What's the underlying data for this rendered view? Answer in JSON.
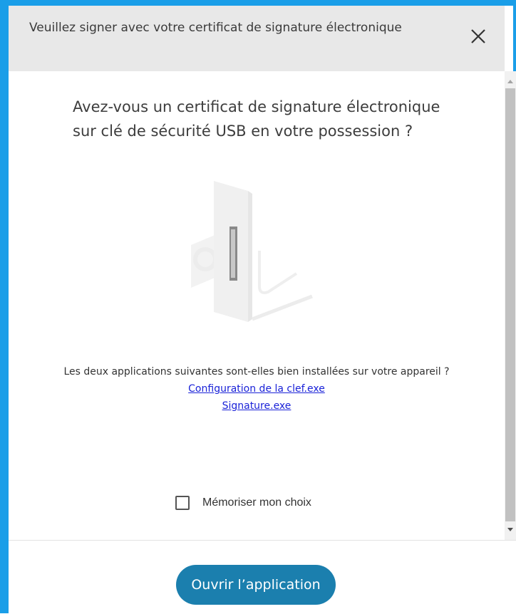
{
  "dialog": {
    "title": "Veuillez signer avec votre certificat de signature électronique",
    "close_icon": "close-icon"
  },
  "content": {
    "question": "Avez-vous un certificat de signature électronique sur clé de sécurité USB en votre possession ?",
    "illustration_icon": "usb-security-key-icon",
    "apps_text": "Les deux applications suivantes sont-elles bien installées sur votre appareil ?",
    "apps": [
      {
        "label": "Configuration de la clef.exe"
      },
      {
        "label": "Signature.exe"
      }
    ],
    "remember_label": "Mémoriser mon choix",
    "remember_checked": false
  },
  "footer": {
    "open_button_label": "Ouvrir l’application"
  },
  "colors": {
    "frame_border": "#1a9ee8",
    "header_bg": "#e8e8e8",
    "link": "#1a22d8",
    "primary_button": "#1b7fae"
  }
}
